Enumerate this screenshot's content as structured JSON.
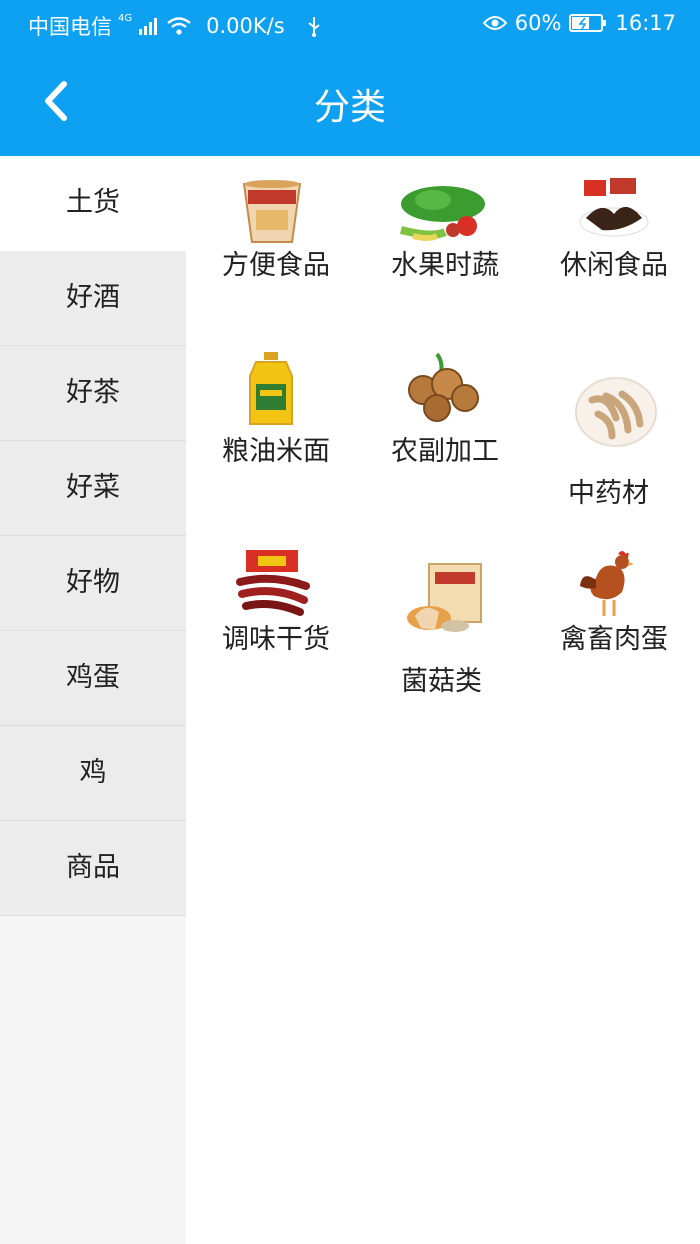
{
  "status": {
    "carrier": "中国电信",
    "network": "4G",
    "speed": "0.00K/s",
    "battery": "60%",
    "time": "16:17"
  },
  "header": {
    "title": "分类"
  },
  "sidebar": {
    "active": 0,
    "items": [
      "土货",
      "好酒",
      "好茶",
      "好菜",
      "好物",
      "鸡蛋",
      "鸡",
      "商品"
    ]
  },
  "grid": {
    "items": [
      {
        "label": "方便食品",
        "icon": "instant-noodle-cup-icon"
      },
      {
        "label": "水果时蔬",
        "icon": "vegetables-icon"
      },
      {
        "label": "休闲食品",
        "icon": "snack-icon"
      },
      {
        "label": "粮油米面",
        "icon": "cooking-oil-icon"
      },
      {
        "label": "农副加工",
        "icon": "walnuts-icon"
      },
      {
        "label": "中药材",
        "icon": "herbal-medicine-icon"
      },
      {
        "label": "调味干货",
        "icon": "dried-chili-icon"
      },
      {
        "label": "菌菇类",
        "icon": "mushroom-pack-icon"
      },
      {
        "label": "禽畜肉蛋",
        "icon": "chicken-icon"
      }
    ]
  },
  "colors": {
    "primary": "#0ea1f2",
    "sidebar_bg": "#ececec"
  }
}
